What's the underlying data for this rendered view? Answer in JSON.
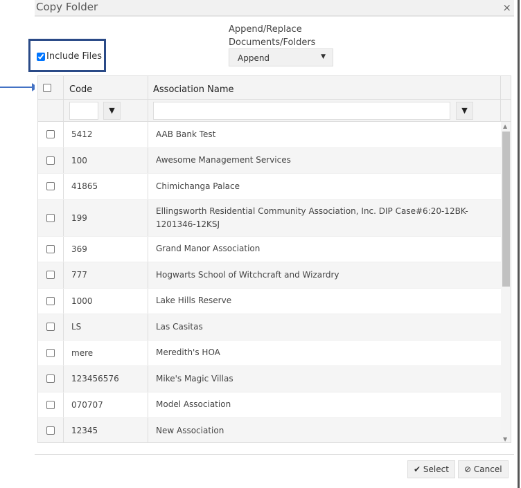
{
  "dialog": {
    "title": "Copy Folder",
    "close": "×"
  },
  "include_files": {
    "label": "Include Files",
    "checked": true
  },
  "append_replace": {
    "label_line1": "Append/Replace",
    "label_line2": "Documents/Folders",
    "value": "Append",
    "caret": "▼"
  },
  "grid": {
    "columns": {
      "code": "Code",
      "name": "Association Name"
    },
    "filter_icon": "▼",
    "rows": [
      {
        "code": "5412",
        "name": "AAB Bank Test"
      },
      {
        "code": "100",
        "name": "Awesome Management Services"
      },
      {
        "code": "41865",
        "name": "Chimichanga Palace"
      },
      {
        "code": "199",
        "name": "Ellingsworth Residential Community Association, Inc. DIP Case#6:20-12BK-1201346-12KSJ"
      },
      {
        "code": "369",
        "name": "Grand Manor Association"
      },
      {
        "code": "777",
        "name": "Hogwarts School of Witchcraft and Wizardry"
      },
      {
        "code": "1000",
        "name": "Lake Hills Reserve"
      },
      {
        "code": "LS",
        "name": "Las Casitas"
      },
      {
        "code": "mere",
        "name": "Meredith's HOA"
      },
      {
        "code": "123456576",
        "name": "Mike's Magic Villas"
      },
      {
        "code": "070707",
        "name": "Model Association"
      },
      {
        "code": "12345",
        "name": "New Association"
      }
    ]
  },
  "buttons": {
    "select": "Select",
    "select_icon": "✔",
    "cancel": "Cancel",
    "cancel_icon": "⊘"
  }
}
